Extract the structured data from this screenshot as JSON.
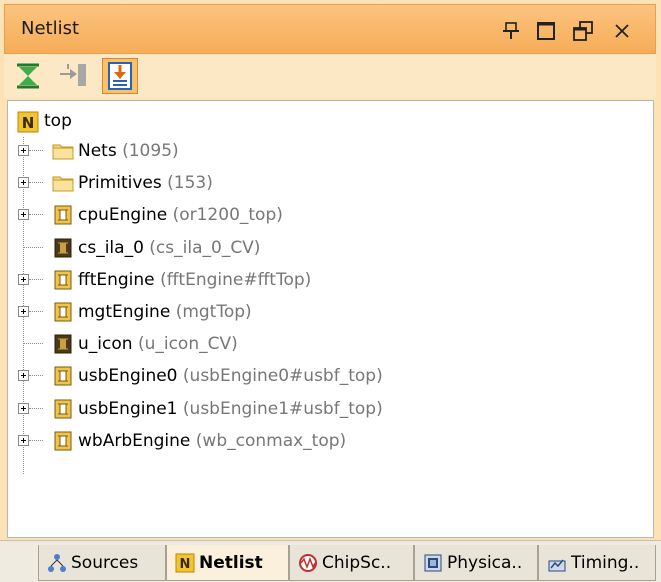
{
  "panel": {
    "title": "Netlist"
  },
  "colors": {
    "titlebar": "#f6ac58",
    "accent": "#f8c16a"
  },
  "window_controls": [
    "pin-icon",
    "maximize-icon",
    "restore-icon",
    "close-icon"
  ],
  "toolbar": {
    "buttons": [
      "collapse-all-icon",
      "show-connectivity-icon",
      "auto-select-icon"
    ]
  },
  "tree": {
    "root": {
      "label": "top"
    },
    "items": [
      {
        "name": "Nets",
        "detail": "(1095)",
        "icon": "folder-icon",
        "expandable": true
      },
      {
        "name": "Primitives",
        "detail": "(153)",
        "icon": "folder-icon",
        "expandable": true
      },
      {
        "name": "cpuEngine",
        "detail": "(or1200_top)",
        "icon": "cell-icon",
        "expandable": true
      },
      {
        "name": "cs_ila_0",
        "detail": "(cs_ila_0_CV)",
        "icon": "black-box-icon",
        "expandable": false
      },
      {
        "name": "fftEngine",
        "detail": "(fftEngine#fftTop)",
        "icon": "cell-icon",
        "expandable": true
      },
      {
        "name": "mgtEngine",
        "detail": "(mgtTop)",
        "icon": "cell-icon",
        "expandable": true
      },
      {
        "name": "u_icon",
        "detail": "(u_icon_CV)",
        "icon": "black-box-icon",
        "expandable": false
      },
      {
        "name": "usbEngine0",
        "detail": "(usbEngine0#usbf_top)",
        "icon": "cell-icon",
        "expandable": true
      },
      {
        "name": "usbEngine1",
        "detail": "(usbEngine1#usbf_top)",
        "icon": "cell-icon",
        "expandable": true
      },
      {
        "name": "wbArbEngine",
        "detail": "(wb_conmax_top)",
        "icon": "cell-icon",
        "expandable": true
      }
    ]
  },
  "tabs": [
    {
      "label": "Sources",
      "icon": "sources-icon",
      "active": false
    },
    {
      "label": "Netlist",
      "icon": "netlist-icon",
      "active": true
    },
    {
      "label": "ChipSc..",
      "icon": "chipscope-icon",
      "active": false
    },
    {
      "label": "Physica..",
      "icon": "physical-icon",
      "active": false
    },
    {
      "label": "Timing..",
      "icon": "timing-icon",
      "active": false
    }
  ]
}
